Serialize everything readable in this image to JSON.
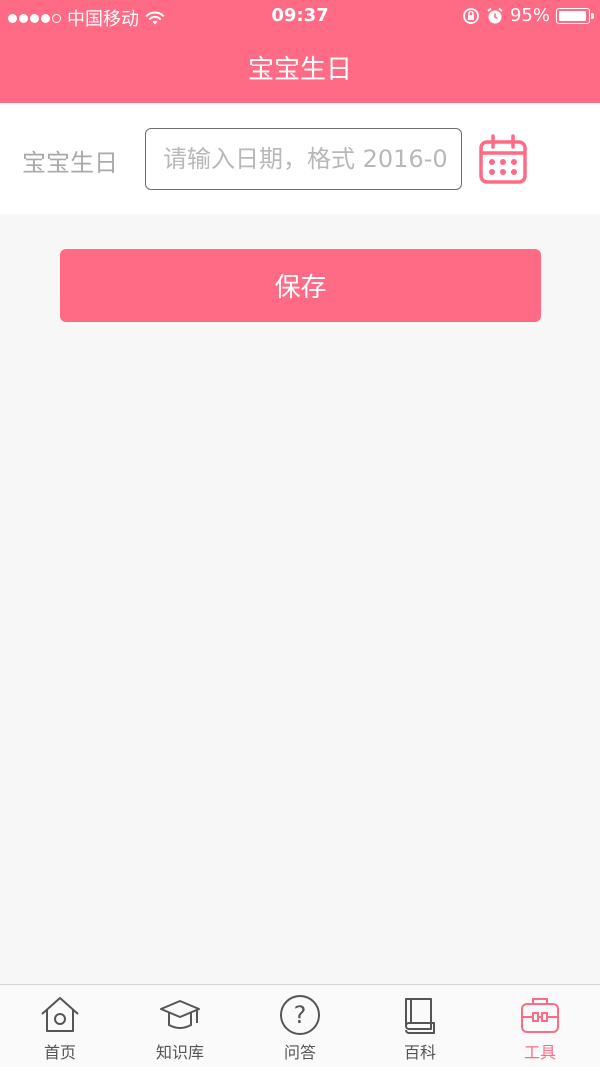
{
  "status_bar": {
    "carrier": "中国移动",
    "time": "09:37",
    "battery": "95%",
    "battery_level": 0.95
  },
  "header": {
    "title": "宝宝生日"
  },
  "form": {
    "label": "宝宝生日",
    "date_placeholder": "请输入日期，格式 2016-0",
    "date_value": ""
  },
  "save_button": {
    "label": "保存"
  },
  "tabs": [
    {
      "label": "首页",
      "icon": "home-icon",
      "active": false
    },
    {
      "label": "知识库",
      "icon": "graduation-cap-icon",
      "active": false
    },
    {
      "label": "问答",
      "icon": "question-icon",
      "active": false
    },
    {
      "label": "百科",
      "icon": "book-icon",
      "active": false
    },
    {
      "label": "工具",
      "icon": "toolbox-icon",
      "active": true
    }
  ],
  "colors": {
    "accent": "#ff6b85",
    "background": "#f7f7f7",
    "inactive_icon": "#555555"
  }
}
